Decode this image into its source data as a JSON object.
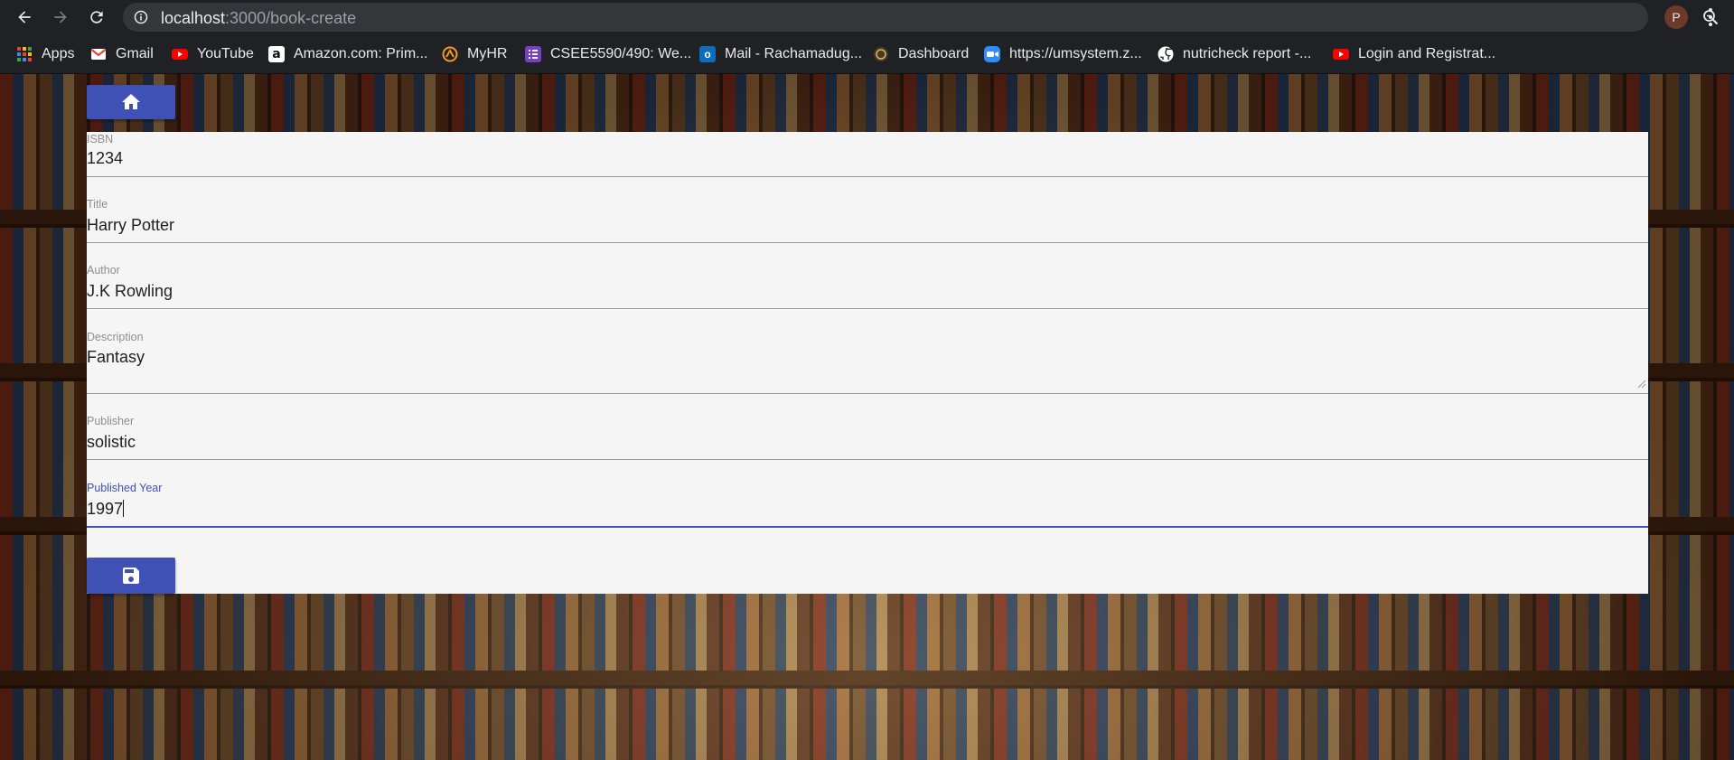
{
  "browser": {
    "url_host": "localhost",
    "url_path": ":3000/book-create",
    "profile_initial": "P"
  },
  "bookmarks": [
    {
      "label": "Apps",
      "icon": "apps-grid-icon"
    },
    {
      "label": "Gmail",
      "icon": "gmail-icon"
    },
    {
      "label": "YouTube",
      "icon": "youtube-icon"
    },
    {
      "label": "Amazon.com: Prim...",
      "icon": "amazon-icon"
    },
    {
      "label": "MyHR",
      "icon": "myhr-icon"
    },
    {
      "label": "CSEE5590/490: We...",
      "icon": "list-icon"
    },
    {
      "label": "Mail - Rachamadug...",
      "icon": "outlook-icon"
    },
    {
      "label": "Dashboard",
      "icon": "dashboard-icon"
    },
    {
      "label": "https://umsystem.z...",
      "icon": "zoom-icon"
    },
    {
      "label": "nutricheck report -...",
      "icon": "github-icon"
    },
    {
      "label": "Login and Registrat...",
      "icon": "youtube-icon"
    }
  ],
  "form": {
    "fields": [
      {
        "label": "ISBN",
        "value": "1234"
      },
      {
        "label": "Title",
        "value": "Harry Potter"
      },
      {
        "label": "Author",
        "value": "J.K Rowling"
      },
      {
        "label": "Description",
        "value": "Fantasy"
      },
      {
        "label": "Publisher",
        "value": "solistic"
      },
      {
        "label": "Published Year",
        "value": "1997"
      }
    ]
  },
  "icons": {
    "home_button": "home-icon",
    "save_button": "floppy-disk-icon"
  },
  "colors": {
    "primary": "#3f51b5",
    "form_bg": "#f5f5f5",
    "chrome_bg": "#202124"
  }
}
